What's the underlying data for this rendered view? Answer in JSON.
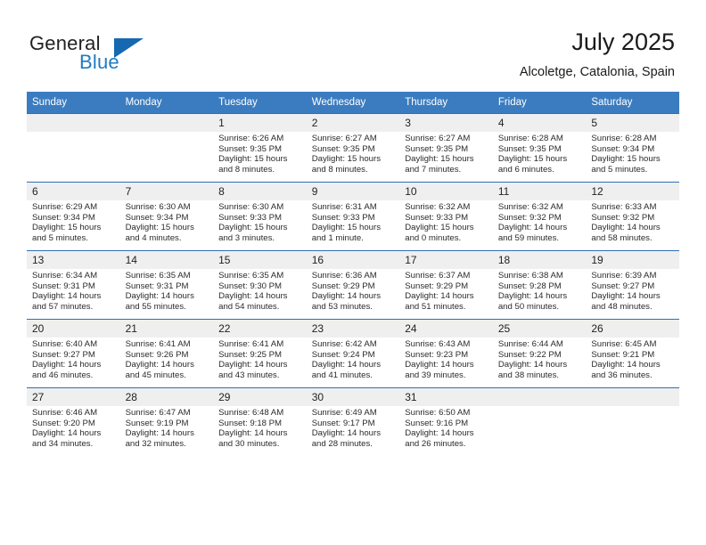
{
  "brand": {
    "name_part1": "General",
    "name_part2": "Blue",
    "accent_color": "#1f7bc1",
    "triangle_color": "#1668b0"
  },
  "header": {
    "title": "July 2025",
    "subtitle": "Alcoletge, Catalonia, Spain"
  },
  "theme": {
    "header_row_bg": "#3b7cc0",
    "row_separator": "#2f6fb5",
    "date_band_bg": "#efefef"
  },
  "weekdays": [
    "Sunday",
    "Monday",
    "Tuesday",
    "Wednesday",
    "Thursday",
    "Friday",
    "Saturday"
  ],
  "labels": {
    "sunrise": "Sunrise:",
    "sunset": "Sunset:",
    "daylight": "Daylight:"
  },
  "weeks": [
    [
      {
        "date": "",
        "empty": true
      },
      {
        "date": "",
        "empty": true
      },
      {
        "date": "1",
        "sunrise": "Sunrise: 6:26 AM",
        "sunset": "Sunset: 9:35 PM",
        "daylight": "Daylight: 15 hours and 8 minutes."
      },
      {
        "date": "2",
        "sunrise": "Sunrise: 6:27 AM",
        "sunset": "Sunset: 9:35 PM",
        "daylight": "Daylight: 15 hours and 8 minutes."
      },
      {
        "date": "3",
        "sunrise": "Sunrise: 6:27 AM",
        "sunset": "Sunset: 9:35 PM",
        "daylight": "Daylight: 15 hours and 7 minutes."
      },
      {
        "date": "4",
        "sunrise": "Sunrise: 6:28 AM",
        "sunset": "Sunset: 9:35 PM",
        "daylight": "Daylight: 15 hours and 6 minutes."
      },
      {
        "date": "5",
        "sunrise": "Sunrise: 6:28 AM",
        "sunset": "Sunset: 9:34 PM",
        "daylight": "Daylight: 15 hours and 5 minutes."
      }
    ],
    [
      {
        "date": "6",
        "sunrise": "Sunrise: 6:29 AM",
        "sunset": "Sunset: 9:34 PM",
        "daylight": "Daylight: 15 hours and 5 minutes."
      },
      {
        "date": "7",
        "sunrise": "Sunrise: 6:30 AM",
        "sunset": "Sunset: 9:34 PM",
        "daylight": "Daylight: 15 hours and 4 minutes."
      },
      {
        "date": "8",
        "sunrise": "Sunrise: 6:30 AM",
        "sunset": "Sunset: 9:33 PM",
        "daylight": "Daylight: 15 hours and 3 minutes."
      },
      {
        "date": "9",
        "sunrise": "Sunrise: 6:31 AM",
        "sunset": "Sunset: 9:33 PM",
        "daylight": "Daylight: 15 hours and 1 minute."
      },
      {
        "date": "10",
        "sunrise": "Sunrise: 6:32 AM",
        "sunset": "Sunset: 9:33 PM",
        "daylight": "Daylight: 15 hours and 0 minutes."
      },
      {
        "date": "11",
        "sunrise": "Sunrise: 6:32 AM",
        "sunset": "Sunset: 9:32 PM",
        "daylight": "Daylight: 14 hours and 59 minutes."
      },
      {
        "date": "12",
        "sunrise": "Sunrise: 6:33 AM",
        "sunset": "Sunset: 9:32 PM",
        "daylight": "Daylight: 14 hours and 58 minutes."
      }
    ],
    [
      {
        "date": "13",
        "sunrise": "Sunrise: 6:34 AM",
        "sunset": "Sunset: 9:31 PM",
        "daylight": "Daylight: 14 hours and 57 minutes."
      },
      {
        "date": "14",
        "sunrise": "Sunrise: 6:35 AM",
        "sunset": "Sunset: 9:31 PM",
        "daylight": "Daylight: 14 hours and 55 minutes."
      },
      {
        "date": "15",
        "sunrise": "Sunrise: 6:35 AM",
        "sunset": "Sunset: 9:30 PM",
        "daylight": "Daylight: 14 hours and 54 minutes."
      },
      {
        "date": "16",
        "sunrise": "Sunrise: 6:36 AM",
        "sunset": "Sunset: 9:29 PM",
        "daylight": "Daylight: 14 hours and 53 minutes."
      },
      {
        "date": "17",
        "sunrise": "Sunrise: 6:37 AM",
        "sunset": "Sunset: 9:29 PM",
        "daylight": "Daylight: 14 hours and 51 minutes."
      },
      {
        "date": "18",
        "sunrise": "Sunrise: 6:38 AM",
        "sunset": "Sunset: 9:28 PM",
        "daylight": "Daylight: 14 hours and 50 minutes."
      },
      {
        "date": "19",
        "sunrise": "Sunrise: 6:39 AM",
        "sunset": "Sunset: 9:27 PM",
        "daylight": "Daylight: 14 hours and 48 minutes."
      }
    ],
    [
      {
        "date": "20",
        "sunrise": "Sunrise: 6:40 AM",
        "sunset": "Sunset: 9:27 PM",
        "daylight": "Daylight: 14 hours and 46 minutes."
      },
      {
        "date": "21",
        "sunrise": "Sunrise: 6:41 AM",
        "sunset": "Sunset: 9:26 PM",
        "daylight": "Daylight: 14 hours and 45 minutes."
      },
      {
        "date": "22",
        "sunrise": "Sunrise: 6:41 AM",
        "sunset": "Sunset: 9:25 PM",
        "daylight": "Daylight: 14 hours and 43 minutes."
      },
      {
        "date": "23",
        "sunrise": "Sunrise: 6:42 AM",
        "sunset": "Sunset: 9:24 PM",
        "daylight": "Daylight: 14 hours and 41 minutes."
      },
      {
        "date": "24",
        "sunrise": "Sunrise: 6:43 AM",
        "sunset": "Sunset: 9:23 PM",
        "daylight": "Daylight: 14 hours and 39 minutes."
      },
      {
        "date": "25",
        "sunrise": "Sunrise: 6:44 AM",
        "sunset": "Sunset: 9:22 PM",
        "daylight": "Daylight: 14 hours and 38 minutes."
      },
      {
        "date": "26",
        "sunrise": "Sunrise: 6:45 AM",
        "sunset": "Sunset: 9:21 PM",
        "daylight": "Daylight: 14 hours and 36 minutes."
      }
    ],
    [
      {
        "date": "27",
        "sunrise": "Sunrise: 6:46 AM",
        "sunset": "Sunset: 9:20 PM",
        "daylight": "Daylight: 14 hours and 34 minutes."
      },
      {
        "date": "28",
        "sunrise": "Sunrise: 6:47 AM",
        "sunset": "Sunset: 9:19 PM",
        "daylight": "Daylight: 14 hours and 32 minutes."
      },
      {
        "date": "29",
        "sunrise": "Sunrise: 6:48 AM",
        "sunset": "Sunset: 9:18 PM",
        "daylight": "Daylight: 14 hours and 30 minutes."
      },
      {
        "date": "30",
        "sunrise": "Sunrise: 6:49 AM",
        "sunset": "Sunset: 9:17 PM",
        "daylight": "Daylight: 14 hours and 28 minutes."
      },
      {
        "date": "31",
        "sunrise": "Sunrise: 6:50 AM",
        "sunset": "Sunset: 9:16 PM",
        "daylight": "Daylight: 14 hours and 26 minutes."
      },
      {
        "date": "",
        "empty": true
      },
      {
        "date": "",
        "empty": true
      }
    ]
  ]
}
